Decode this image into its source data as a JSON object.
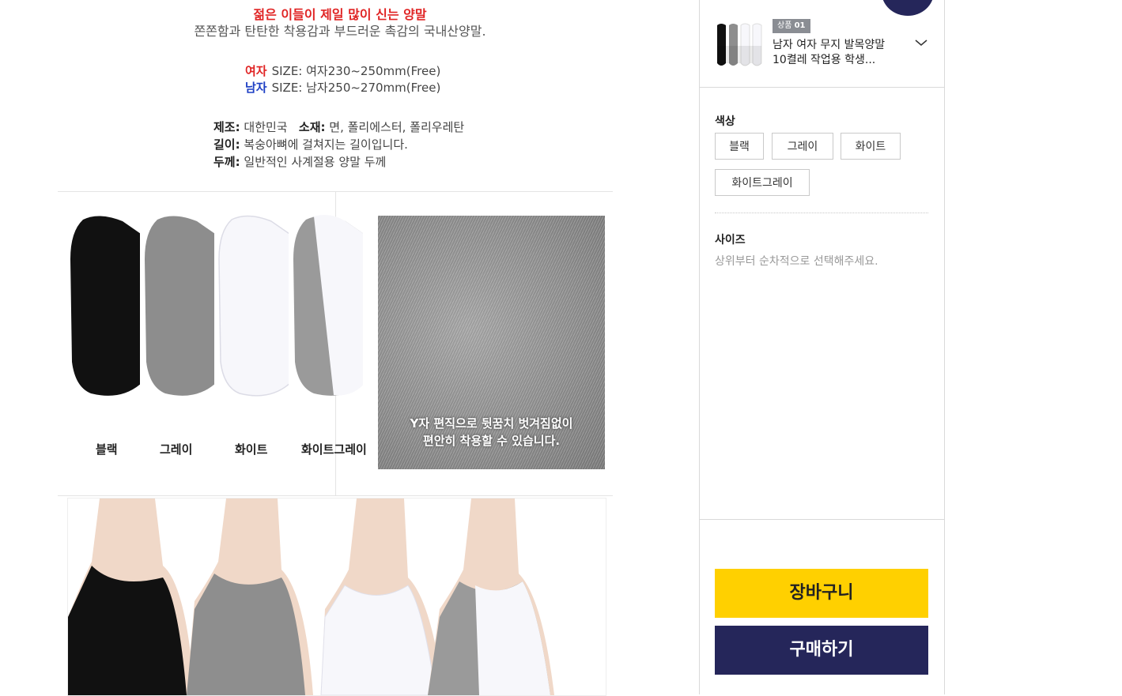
{
  "detail": {
    "tagline": "젊은 이들이 제일 많이 신는 양말",
    "description": "쫀쫀함과 탄탄한 착용감과 부드러운 촉감의 국내산양말.",
    "sizes": [
      {
        "label": "여자",
        "text": "SIZE: 여자230~250mm(Free)"
      },
      {
        "label": "남자",
        "text": "SIZE: 남자250~270mm(Free)"
      }
    ],
    "specs": {
      "made_label": "제조:",
      "made_value": "대한민국",
      "material_label": "소재:",
      "material_value": "면, 폴리에스터, 폴리우레탄",
      "length_label": "길이:",
      "length_value": "복숭아뼈에 걸쳐지는 길이입니다.",
      "thickness_label": "두께:",
      "thickness_value": "일반적인 사계절용 양말 두께"
    },
    "color_labels": [
      "블랙",
      "그레이",
      "화이트",
      "화이트그레이"
    ],
    "knit_caption_1": "Y자 편직으로 뒷꿈치 벗겨짐없이",
    "knit_caption_2": "편안히 착용할 수 있습니다."
  },
  "panel": {
    "product_tag_prefix": "상품",
    "product_tag_num": "01",
    "product_name": "남자 여자 무지 발목양말 10켤레 작업용 학생...",
    "color_label": "색상",
    "color_options": [
      "블랙",
      "그레이",
      "화이트",
      "화이트그레이"
    ],
    "size_label": "사이즈",
    "size_hint": "상위부터 순차적으로 선택해주세요.",
    "cart_button": "장바구니",
    "buy_button": "구매하기"
  },
  "colors": {
    "accent_yellow": "#ffd000",
    "accent_navy": "#25265a",
    "female_red": "#e02424",
    "male_blue": "#1d3fc4"
  }
}
